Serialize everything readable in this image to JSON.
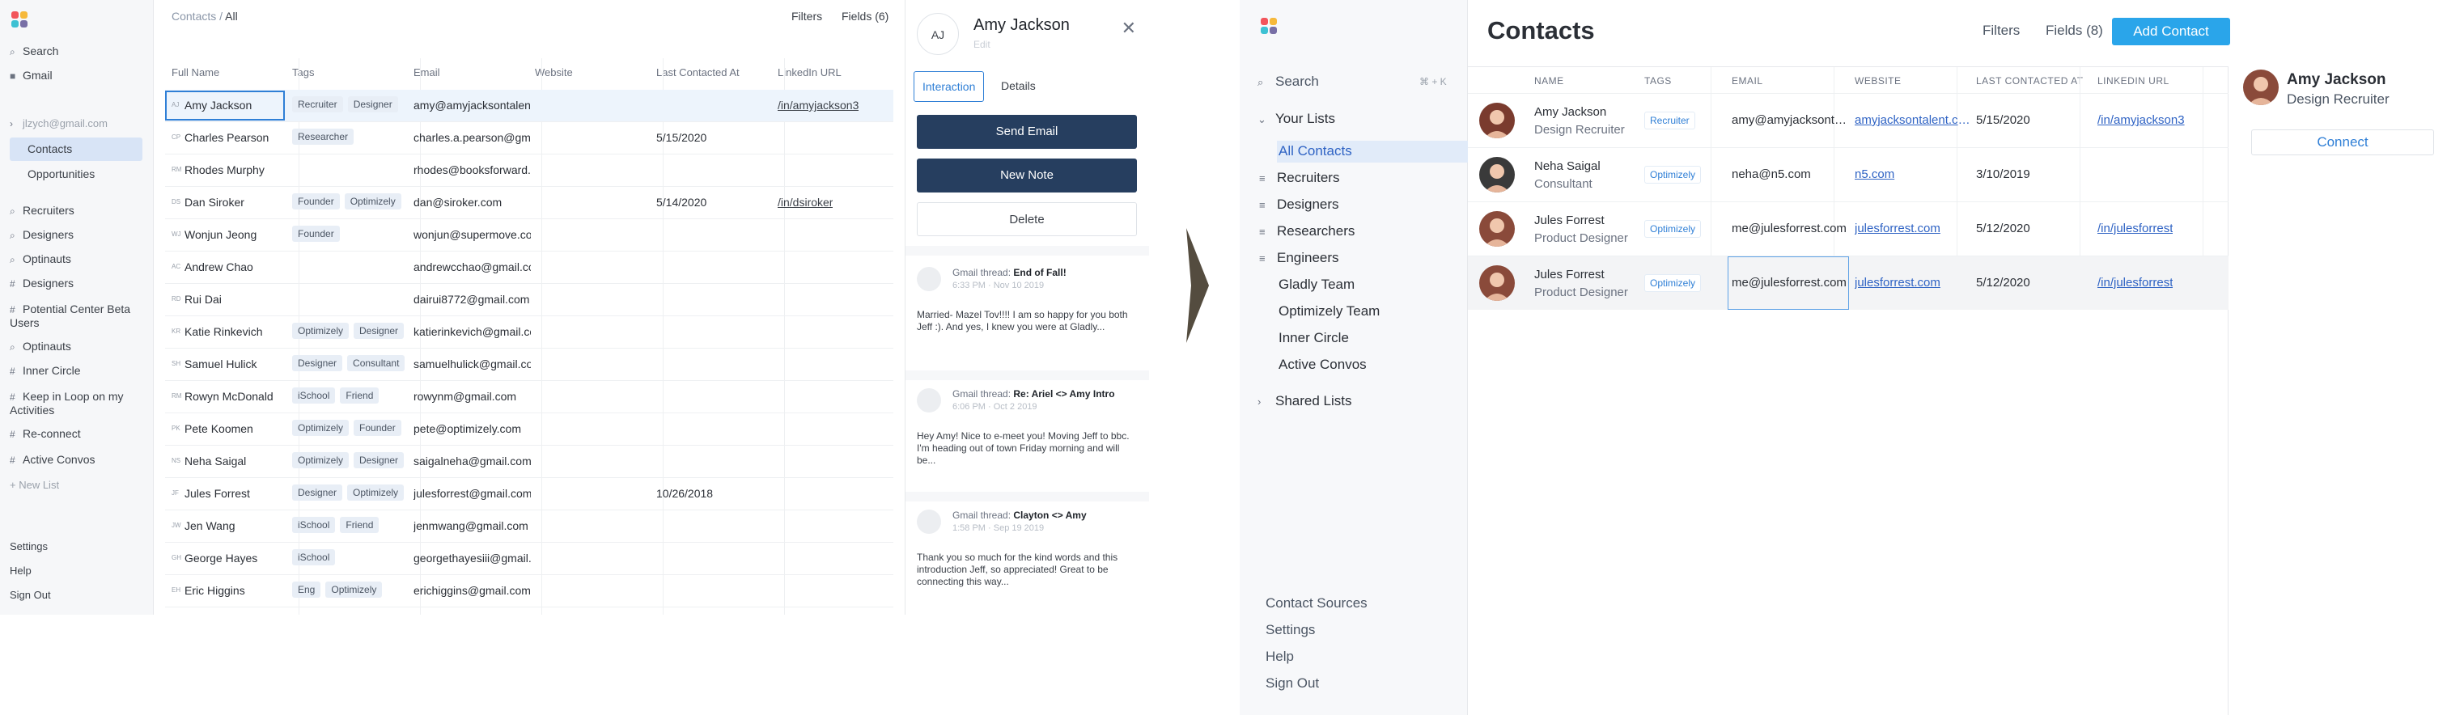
{
  "left_app": {
    "sidebar": {
      "search": "Search",
      "gmail": "Gmail",
      "account": "jlzych@gmail.com",
      "contacts": "Contacts",
      "opportunities": "Opportunities",
      "lists": [
        {
          "icon": "search-icon",
          "label": "Recruiters"
        },
        {
          "icon": "search-icon",
          "label": "Designers"
        },
        {
          "icon": "search-icon",
          "label": "Optinauts"
        },
        {
          "icon": "hash-icon",
          "label": "Designers"
        },
        {
          "icon": "hash-icon",
          "label": "Potential Center Beta Users"
        },
        {
          "icon": "search-icon",
          "label": "Optinauts"
        },
        {
          "icon": "hash-icon",
          "label": "Inner Circle"
        },
        {
          "icon": "hash-icon",
          "label": "Keep in Loop on my Activities"
        },
        {
          "icon": "hash-icon",
          "label": "Re-connect"
        },
        {
          "icon": "hash-icon",
          "label": "Active Convos"
        }
      ],
      "new_list": "+ New List",
      "settings": "Settings",
      "help": "Help",
      "sign_out": "Sign Out"
    },
    "header": {
      "crumb_root": "Contacts",
      "crumb_sep": " / ",
      "crumb_current": "All",
      "filters": "Filters",
      "fields": "Fields (6)"
    },
    "columns": [
      "Full Name",
      "Tags",
      "Email",
      "Website",
      "Last Contacted At",
      "LinkedIn URL"
    ],
    "rows": [
      {
        "ini": "AJ",
        "name": "Amy Jackson",
        "tags": [
          "Recruiter",
          "Designer"
        ],
        "email": "amy@amyjacksontalent.com",
        "last": "",
        "linkedin": "/in/amyjackson3"
      },
      {
        "ini": "CP",
        "name": "Charles Pearson",
        "tags": [
          "Researcher"
        ],
        "email": "charles.a.pearson@gmail.com",
        "last": "5/15/2020",
        "linkedin": ""
      },
      {
        "ini": "RM",
        "name": "Rhodes Murphy",
        "tags": [],
        "email": "rhodes@booksforward.com",
        "last": "",
        "linkedin": ""
      },
      {
        "ini": "DS",
        "name": "Dan Siroker",
        "tags": [
          "Founder",
          "Optimizely"
        ],
        "email": "dan@siroker.com",
        "last": "5/14/2020",
        "linkedin": "/in/dsiroker"
      },
      {
        "ini": "WJ",
        "name": "Wonjun Jeong",
        "tags": [
          "Founder"
        ],
        "email": "wonjun@supermove.co",
        "last": "",
        "linkedin": ""
      },
      {
        "ini": "AC",
        "name": "Andrew Chao",
        "tags": [],
        "email": "andrewcchao@gmail.com",
        "last": "",
        "linkedin": ""
      },
      {
        "ini": "RD",
        "name": "Rui Dai",
        "tags": [],
        "email": "dairui8772@gmail.com",
        "last": "",
        "linkedin": ""
      },
      {
        "ini": "KR",
        "name": "Katie Rinkevich",
        "tags": [
          "Optimizely",
          "Designer"
        ],
        "email": "katierinkevich@gmail.com",
        "last": "",
        "linkedin": ""
      },
      {
        "ini": "SH",
        "name": "Samuel Hulick",
        "tags": [
          "Designer",
          "Consultant"
        ],
        "email": "samuelhulick@gmail.com",
        "last": "",
        "linkedin": ""
      },
      {
        "ini": "RM",
        "name": "Rowyn McDonald",
        "tags": [
          "iSchool",
          "Friend"
        ],
        "email": "rowynm@gmail.com",
        "last": "",
        "linkedin": ""
      },
      {
        "ini": "PK",
        "name": "Pete Koomen",
        "tags": [
          "Optimizely",
          "Founder"
        ],
        "email": "pete@optimizely.com",
        "last": "",
        "linkedin": ""
      },
      {
        "ini": "NS",
        "name": "Neha Saigal",
        "tags": [
          "Optimizely",
          "Designer"
        ],
        "email": "saigalneha@gmail.com",
        "last": "",
        "linkedin": ""
      },
      {
        "ini": "JF",
        "name": "Jules Forrest",
        "tags": [
          "Designer",
          "Optimizely"
        ],
        "email": "julesforrest@gmail.com",
        "last": "10/26/2018",
        "linkedin": ""
      },
      {
        "ini": "JW",
        "name": "Jen Wang",
        "tags": [
          "iSchool",
          "Friend"
        ],
        "email": "jenmwang@gmail.com",
        "last": "",
        "linkedin": ""
      },
      {
        "ini": "GH",
        "name": "George Hayes",
        "tags": [
          "iSchool"
        ],
        "email": "georgethayesiii@gmail.com",
        "last": "",
        "linkedin": ""
      },
      {
        "ini": "EH",
        "name": "Eric Higgins",
        "tags": [
          "Eng",
          "Optimizely"
        ],
        "email": "erichiggins@gmail.com",
        "last": "",
        "linkedin": ""
      }
    ],
    "detail": {
      "initials": "AJ",
      "name": "Amy Jackson",
      "subtitle": "Edit",
      "tab_interaction": "Interaction",
      "tab_details": "Details",
      "send_email": "Send Email",
      "new_note": "New Note",
      "delete": "Delete",
      "threads": [
        {
          "prefix": "Gmail thread: ",
          "subject": "End of Fall!",
          "meta": "6:33 PM · Nov 10 2019",
          "body": "Married- Mazel Tov!!!! I am so happy for you both Jeff :). And yes, I knew you were at Gladly..."
        },
        {
          "prefix": "Gmail thread: ",
          "subject": "Re: Ariel <> Amy Intro",
          "meta": "6:06 PM · Oct 2 2019",
          "body": "Hey Amy! Nice to e-meet you! Moving Jeff to bbc. I'm heading out of town Friday morning and will be..."
        },
        {
          "prefix": "Gmail thread: ",
          "subject": "Clayton <> Amy",
          "meta": "1:58 PM · Sep 19 2019",
          "body": "Thank you so much for the kind words and this introduction Jeff, so appreciated! Great to be connecting this way..."
        }
      ]
    }
  },
  "right_app": {
    "sidebar": {
      "search": "Search",
      "shortcut": "⌘ + K",
      "your_lists": "Your Lists",
      "all_contacts": "All Contacts",
      "filter_lists": [
        "Recruiters",
        "Designers",
        "Researchers",
        "Engineers"
      ],
      "plain_lists": [
        "Gladly Team",
        "Optimizely Team",
        "Inner Circle",
        "Active Convos"
      ],
      "shared_lists": "Shared Lists",
      "contact_sources": "Contact Sources",
      "settings": "Settings",
      "help": "Help",
      "sign_out": "Sign Out"
    },
    "header": {
      "title": "Contacts",
      "filters": "Filters",
      "fields": "Fields (8)",
      "add_contact": "Add Contact"
    },
    "columns": [
      "NAME",
      "TAGS",
      "EMAIL",
      "WEBSITE",
      "LAST CONTACTED AT",
      "LINKEDIN URL"
    ],
    "rows": [
      {
        "name": "Amy Jackson",
        "role": "Design Recruiter",
        "tag": "Recruiter",
        "email": "amy@amyjacksontalent.com",
        "website": "amyjacksontalent.com",
        "last": "5/15/2020",
        "linkedin": "/in/amyjackson3"
      },
      {
        "name": "Neha Saigal",
        "role": "Consultant",
        "tag": "Optimizely",
        "email": "neha@n5.com",
        "website": "n5.com",
        "last": "3/10/2019",
        "linkedin": ""
      },
      {
        "name": "Jules Forrest",
        "role": "Product Designer",
        "tag": "Optimizely",
        "email": "me@julesforrest.com",
        "website": "julesforrest.com",
        "last": "5/12/2020",
        "linkedin": "/in/julesforrest"
      },
      {
        "name": "Jules Forrest",
        "role": "Product Designer",
        "tag": "Optimizely",
        "email": "me@julesforrest.com",
        "website": "julesforrest.com",
        "last": "5/12/2020",
        "linkedin": "/in/julesforrest"
      }
    ],
    "profile": {
      "name": "Amy Jackson",
      "role": "Design Recruiter",
      "connect": "Connect"
    }
  },
  "colors": {
    "accent": "#2f7fd6",
    "dark_button": "#263e5f",
    "add_button": "#2aa5ea",
    "selected_row": "#edf4fc"
  }
}
